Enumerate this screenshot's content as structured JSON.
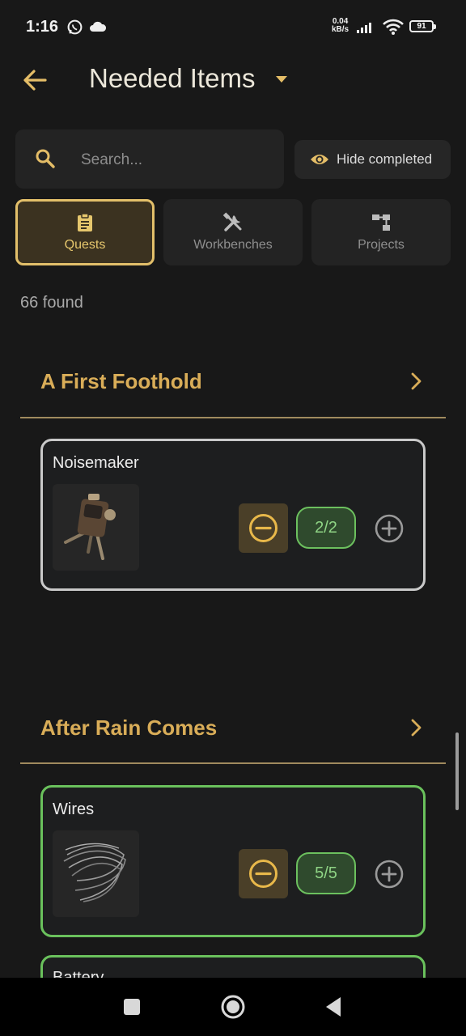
{
  "status_bar": {
    "time": "1:16",
    "speed_value": "0.04",
    "speed_unit": "kB/s",
    "battery": "91",
    "icons": [
      "whatsapp-icon",
      "cloud-icon",
      "signal-icon",
      "wifi-icon",
      "battery-icon"
    ]
  },
  "header": {
    "title": "Needed Items",
    "icons": [
      "back-arrow-icon",
      "dropdown-caret-icon"
    ]
  },
  "search": {
    "placeholder": "Search...",
    "value": ""
  },
  "filter": {
    "hide_completed_label": "Hide completed"
  },
  "tabs": [
    {
      "label": "Quests",
      "icon": "clipboard-icon",
      "active": true
    },
    {
      "label": "Workbenches",
      "icon": "tools-icon",
      "active": false
    },
    {
      "label": "Projects",
      "icon": "hierarchy-icon",
      "active": false
    }
  ],
  "results": {
    "found_text": "66 found"
  },
  "sections": [
    {
      "title": "A First Foothold",
      "items": [
        {
          "name": "Noisemaker",
          "count": "2/2",
          "image": "noisemaker-item-image"
        }
      ]
    },
    {
      "title": "After Rain Comes",
      "items": [
        {
          "name": "Wires",
          "count": "5/5",
          "image": "wires-item-image"
        },
        {
          "name": "Battery"
        }
      ]
    }
  ],
  "colors": {
    "background": "#181818",
    "accent_gold": "#d9ad58",
    "complete_green": "#6ac15c",
    "card_border_grey": "#c9c9c9"
  }
}
